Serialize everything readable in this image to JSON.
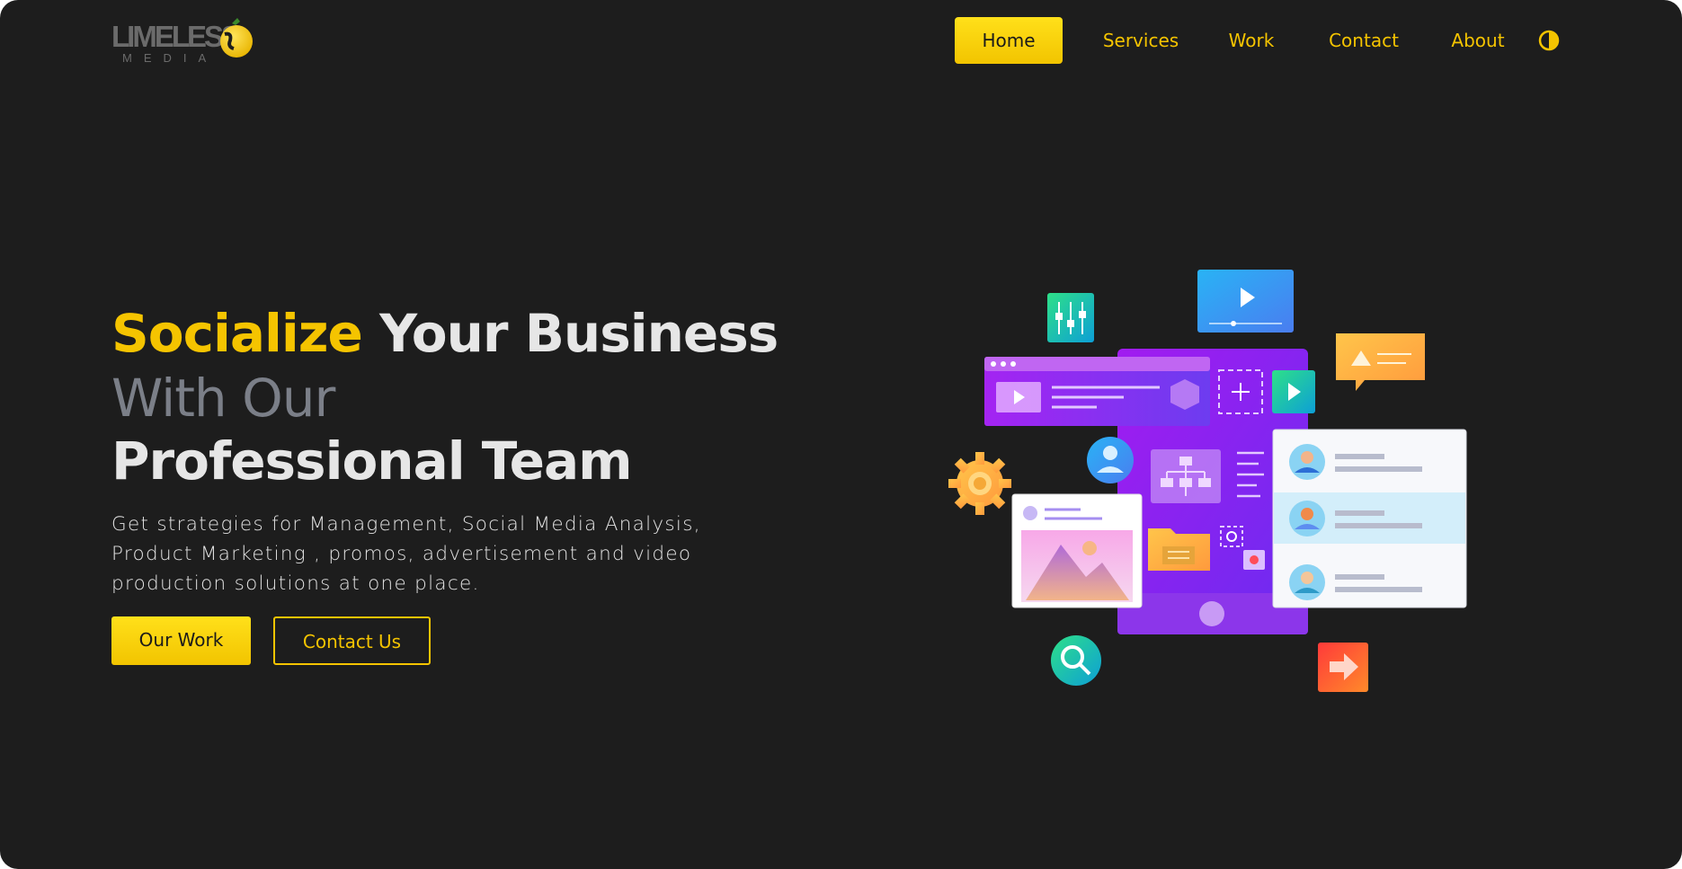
{
  "brand": {
    "name": "LIMELESS",
    "sub": "MEDIA"
  },
  "nav": {
    "items": [
      {
        "label": "Home",
        "active": true
      },
      {
        "label": "Services",
        "active": false
      },
      {
        "label": "Work",
        "active": false
      },
      {
        "label": "Contact",
        "active": false
      },
      {
        "label": "About",
        "active": false
      }
    ],
    "theme_toggle_icon": "contrast-icon"
  },
  "hero": {
    "highlight": "Socialize",
    "line1_rest": "Your Business",
    "line2": "With Our",
    "line3": "Professional Team",
    "description_line1": "Get strategies for Management, Social Media Analysis,",
    "description_line2": "Product Marketing , promos, advertisement and video",
    "description_line3": "production solutions at one place.",
    "primary_button": "Our Work",
    "secondary_button": "Contact Us"
  },
  "colors": {
    "background": "#1d1d1d",
    "accent": "#f5c400",
    "heading": "#e6e6e6",
    "muted": "#7b7f88"
  }
}
